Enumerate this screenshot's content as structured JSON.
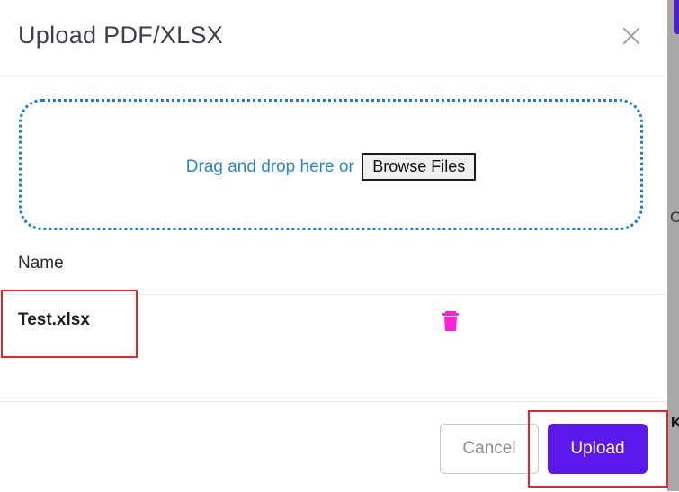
{
  "modal": {
    "title": "Upload PDF/XLSX",
    "close_icon": "close-icon"
  },
  "dropzone": {
    "text": "Drag and drop here or",
    "browse_label": "Browse Files"
  },
  "files": {
    "column_header": "Name",
    "items": [
      {
        "name": "Test.xlsx",
        "action_icon": "trash-icon",
        "action_color": "#ff1fd8"
      }
    ]
  },
  "footer": {
    "cancel_label": "Cancel",
    "upload_label": "Upload"
  },
  "backdrop": {
    "glyph_c": "C",
    "glyph_k": "K"
  },
  "colors": {
    "accent": "#5a18ea",
    "link": "#2a87c8",
    "highlight": "#e3262c"
  }
}
